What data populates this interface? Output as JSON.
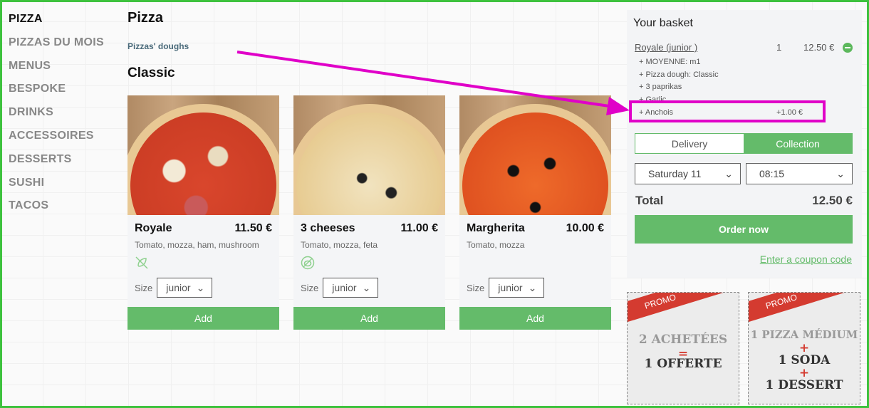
{
  "sidebar": {
    "items": [
      "PIZZA",
      "PIZZAS DU MOIS",
      "MENUS",
      "BESPOKE",
      "DRINKS",
      "ACCESSOIRES",
      "DESSERTS",
      "SUSHI",
      "TACOS"
    ]
  },
  "main": {
    "title": "Pizza",
    "doughs_link": "Pizzas' doughs",
    "section": "Classic",
    "products": [
      {
        "name": "Royale",
        "price": "11.50 €",
        "desc": "Tomato, mozza, ham, mushroom",
        "icon": "no-gluten-icon",
        "size_label": "Size",
        "size": "junior",
        "add": "Add"
      },
      {
        "name": "3 cheeses",
        "price": "11.00 €",
        "desc": "Tomato, mozza, feta",
        "icon": "no-pork-icon",
        "size_label": "Size",
        "size": "junior",
        "add": "Add"
      },
      {
        "name": "Margherita",
        "price": "10.00 €",
        "desc": "Tomato, mozza",
        "size_label": "Size",
        "size": "junior",
        "add": "Add"
      }
    ]
  },
  "basket": {
    "title": "Your basket",
    "item": {
      "name": "Royale (junior )",
      "qty": "1",
      "price": "12.50 €"
    },
    "options": [
      "+ MOYENNE: m1",
      "+ Pizza dough: Classic",
      "+ 3 paprikas",
      "+ Garlic",
      "+ Anchois"
    ],
    "anchois_price": "+1.00 €",
    "delivery": "Delivery",
    "collection": "Collection",
    "day": "Saturday 11",
    "time": "08:15",
    "total_label": "Total",
    "total": "12.50 €",
    "order": "Order now",
    "coupon": "Enter a coupon code"
  },
  "promos": [
    {
      "ribbon": "PROMO",
      "lines": [
        "2 ACHETÉES",
        "=",
        "1 OFFERTE"
      ]
    },
    {
      "ribbon": "PROMO",
      "lines": [
        "1 PIZZA MÉDIUM",
        "+",
        "1 SODA",
        "+",
        "1 DESSERT"
      ]
    }
  ],
  "colors": {
    "accent": "#64bb6a",
    "annotation": "#e000c8",
    "frame": "#3ec23e"
  }
}
